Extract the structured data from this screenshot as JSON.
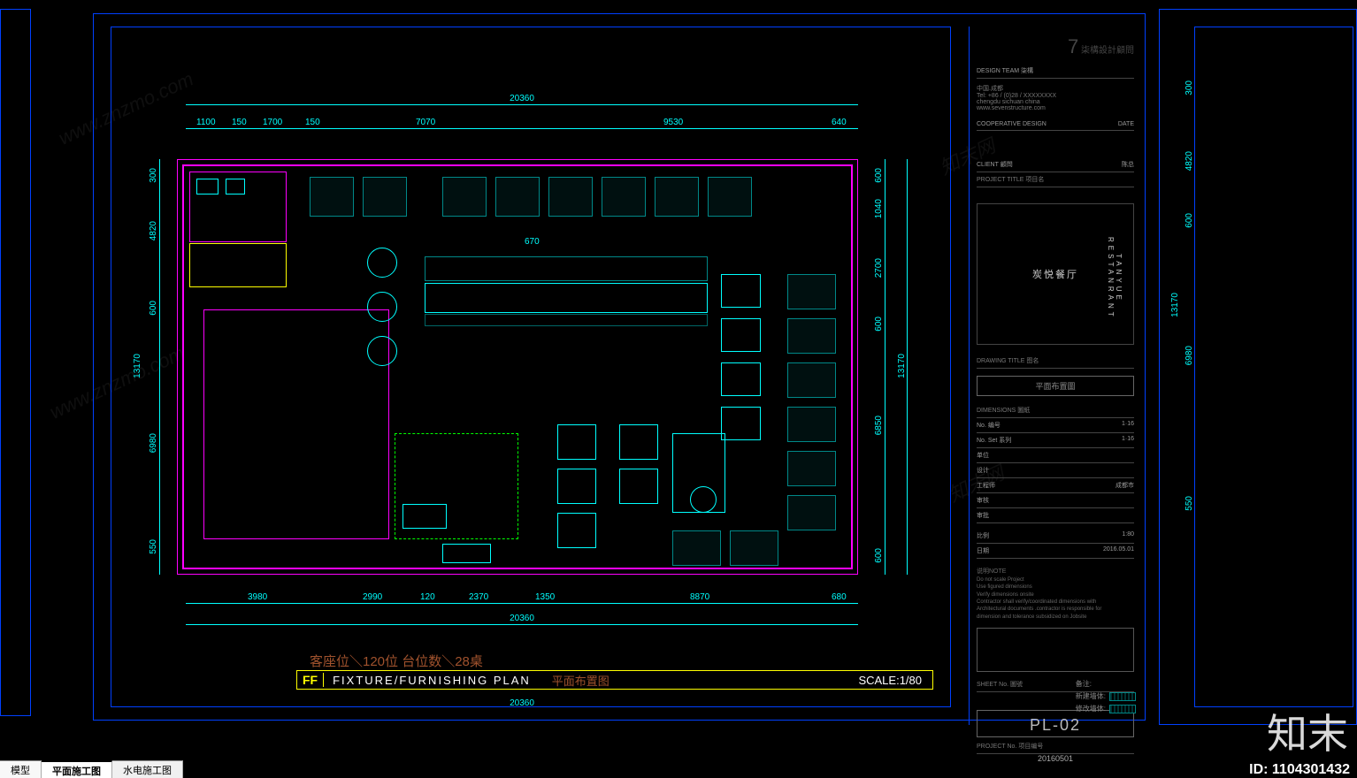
{
  "watermarks": [
    "www.znzmo.com",
    "www.znzmo.com",
    "www.znzmo.com",
    "www.znzmo.com",
    "知末网",
    "知末网"
  ],
  "dims": {
    "top_total": "20360",
    "top_segs": [
      "1100",
      "150",
      "1700",
      "150",
      "7070",
      "9530",
      "640"
    ],
    "bottom_total": "20360",
    "bottom_segs": [
      "3980",
      "2990",
      "120",
      "2370",
      "1350",
      "8870",
      "680"
    ],
    "bottom_extra": "20360",
    "left": [
      "300",
      "4820",
      "600",
      "13170",
      "6980",
      "550"
    ],
    "right": [
      "600",
      "1040",
      "2700",
      "600",
      "13170",
      "6850",
      "600"
    ],
    "center": "670"
  },
  "dims_right_crop": {
    "left": [
      "300",
      "4820",
      "600",
      "13170",
      "6980",
      "550"
    ]
  },
  "seats_label": "客座位＼120位    台位数＼28桌",
  "title": {
    "code": "FF",
    "en": "FIXTURE/FURNISHING PLAN",
    "cn": "平面布置图",
    "scale": "SCALE:1/80"
  },
  "title_block": {
    "studio_cn": "柒構設計顧問",
    "design_team": "DESIGN TEAM 柒構",
    "address_head": "中国.成都",
    "address_lines": [
      "Tel: +86 / (0)28 / XXXXXXXX",
      "chengdu sichuan china",
      "www.sevenstructure.com"
    ],
    "coop": "COOPERATIVE DESIGN",
    "date_label": "DATE",
    "client_label": "CLIENT 顧問",
    "client_value": "陈总",
    "project_label": "PROJECT TITLE 项目名",
    "project_cn": "炭悦餐厅",
    "project_en": "TANYUE RESTANRANT",
    "drawing_title_label": "DRAWING TITLE 图名",
    "drawing_title": "平面布置圖",
    "dimensions_label": "DIMENSIONS 圖紙",
    "dim_rows": [
      {
        "k": "No. 编号",
        "v": "1·16"
      },
      {
        "k": "No. Set 系列",
        "v": "1·16"
      },
      {
        "k": "单位",
        "v": ""
      },
      {
        "k": "设计",
        "v": ""
      },
      {
        "k": "工程师",
        "v": "成都市"
      },
      {
        "k": "审核",
        "v": ""
      },
      {
        "k": "审批",
        "v": ""
      }
    ],
    "scale_row": {
      "k": "比例",
      "v": "1:80"
    },
    "date_row": {
      "k": "日期",
      "v": "2016.05.01"
    },
    "notes_head": "说明NOTE",
    "notes": [
      "Do not scale Project",
      "Use figured dimensions",
      "Verify dimensions onsite",
      "Contractor shall verify/coordinated dimensions with",
      "Architectural documents .contractor is responsible for",
      "dimension and tolerance subsidized on Jobsite"
    ],
    "legend": [
      {
        "label": "备注:",
        "sw": false
      },
      {
        "label": "新建墙体:",
        "sw": true
      },
      {
        "label": "修改墙体:",
        "sw": true
      }
    ],
    "sheet_label": "SHEET No. 圖號",
    "sheet_no": "PL-02",
    "project_no_label": "PROJECT No. 项目编号",
    "project_no": "20160501"
  },
  "tabs": [
    "模型",
    "平面施工图",
    "水电施工图"
  ],
  "active_tab": 1,
  "brand": "知末",
  "asset_id": "ID: 1104301432"
}
